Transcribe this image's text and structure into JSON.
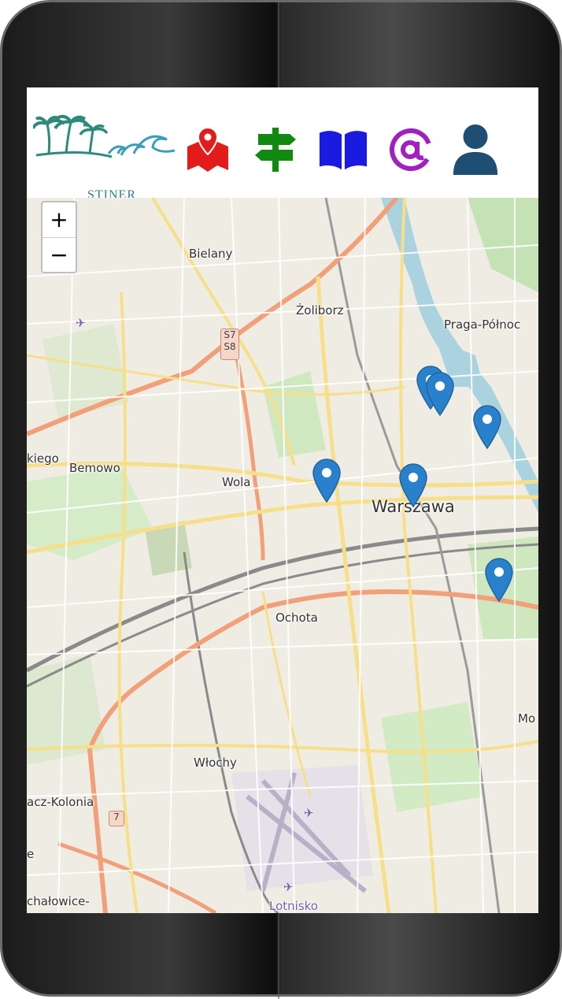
{
  "navbar": {
    "logo_text": "STINER",
    "icons": [
      "map-marker-icon",
      "signpost-icon",
      "book-icon",
      "at-sign-icon",
      "user-icon"
    ],
    "icon_colors": {
      "map": "#e31b1b",
      "signpost": "#128a12",
      "book": "#1a1ae0",
      "at": "#a020c0",
      "user": "#1f4e74"
    }
  },
  "map": {
    "zoom_in": "+",
    "zoom_out": "−",
    "places": {
      "bielany": "Bielany",
      "zoliborz": "Żoliborz",
      "praga": "Praga-Północ",
      "bemowo": "Bemowo",
      "kiego": "kiego",
      "wola": "Wola",
      "warszawa": "Warszawa",
      "ochota": "Ochota",
      "wlochy": "Włochy",
      "kolonia": "acz-Kolonia",
      "chalowice": "chałowice-",
      "lotnisko": "Lotnisko",
      "mo": "Mo",
      "e": "e"
    },
    "shields": {
      "s7": "S7",
      "s8": "S8",
      "r7": "7"
    }
  }
}
